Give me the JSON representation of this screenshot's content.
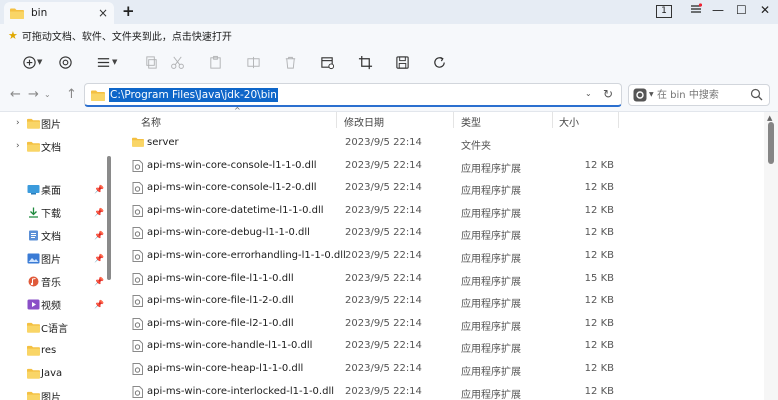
{
  "window": {
    "tab_title": "bin",
    "close_tab": "×",
    "new_tab": "+",
    "counter": "1",
    "min_label": "—",
    "max_label": "☐",
    "close_label": "✕"
  },
  "notice": {
    "text": "可拖动文档、软件、文件夹到此，点击快速打开"
  },
  "address": {
    "path": "C:\\Program Files\\Java\\jdk-20\\bin",
    "search_placeholder": "在 bin 中搜索"
  },
  "columns": {
    "name": "名称",
    "date": "修改日期",
    "type": "类型",
    "size": "大小"
  },
  "sidebar": {
    "items": [
      {
        "label": "图片",
        "icon": "folder-icon"
      },
      {
        "label": "文档",
        "icon": "folder-icon"
      },
      {
        "label": "桌面",
        "icon": "desktop-icon"
      },
      {
        "label": "下载",
        "icon": "download-icon"
      },
      {
        "label": "文档",
        "icon": "document-icon"
      },
      {
        "label": "图片",
        "icon": "picture-icon"
      },
      {
        "label": "音乐",
        "icon": "music-icon"
      },
      {
        "label": "视频",
        "icon": "video-icon"
      },
      {
        "label": "C语言",
        "icon": "folder-icon"
      },
      {
        "label": "res",
        "icon": "folder-icon"
      },
      {
        "label": "Java",
        "icon": "folder-icon"
      },
      {
        "label": "图片",
        "icon": "folder-icon"
      }
    ]
  },
  "files": [
    {
      "name": "server",
      "date": "2023/9/5 22:14",
      "type": "文件夹",
      "size": "",
      "kind": "folder"
    },
    {
      "name": "api-ms-win-core-console-l1-1-0.dll",
      "date": "2023/9/5 22:14",
      "type": "应用程序扩展",
      "size": "12 KB",
      "kind": "dll"
    },
    {
      "name": "api-ms-win-core-console-l1-2-0.dll",
      "date": "2023/9/5 22:14",
      "type": "应用程序扩展",
      "size": "12 KB",
      "kind": "dll"
    },
    {
      "name": "api-ms-win-core-datetime-l1-1-0.dll",
      "date": "2023/9/5 22:14",
      "type": "应用程序扩展",
      "size": "12 KB",
      "kind": "dll"
    },
    {
      "name": "api-ms-win-core-debug-l1-1-0.dll",
      "date": "2023/9/5 22:14",
      "type": "应用程序扩展",
      "size": "12 KB",
      "kind": "dll"
    },
    {
      "name": "api-ms-win-core-errorhandling-l1-1-0.dll",
      "date": "2023/9/5 22:14",
      "type": "应用程序扩展",
      "size": "12 KB",
      "kind": "dll"
    },
    {
      "name": "api-ms-win-core-file-l1-1-0.dll",
      "date": "2023/9/5 22:14",
      "type": "应用程序扩展",
      "size": "15 KB",
      "kind": "dll"
    },
    {
      "name": "api-ms-win-core-file-l1-2-0.dll",
      "date": "2023/9/5 22:14",
      "type": "应用程序扩展",
      "size": "12 KB",
      "kind": "dll"
    },
    {
      "name": "api-ms-win-core-file-l2-1-0.dll",
      "date": "2023/9/5 22:14",
      "type": "应用程序扩展",
      "size": "12 KB",
      "kind": "dll"
    },
    {
      "name": "api-ms-win-core-handle-l1-1-0.dll",
      "date": "2023/9/5 22:14",
      "type": "应用程序扩展",
      "size": "12 KB",
      "kind": "dll"
    },
    {
      "name": "api-ms-win-core-heap-l1-1-0.dll",
      "date": "2023/9/5 22:14",
      "type": "应用程序扩展",
      "size": "12 KB",
      "kind": "dll"
    },
    {
      "name": "api-ms-win-core-interlocked-l1-1-0.dll",
      "date": "2023/9/5 22:14",
      "type": "应用程序扩展",
      "size": "12 KB",
      "kind": "dll"
    }
  ],
  "colors": {
    "accent": "#0e66c9",
    "folder": "#f4c042",
    "titlebar": "#e6ecf4"
  }
}
